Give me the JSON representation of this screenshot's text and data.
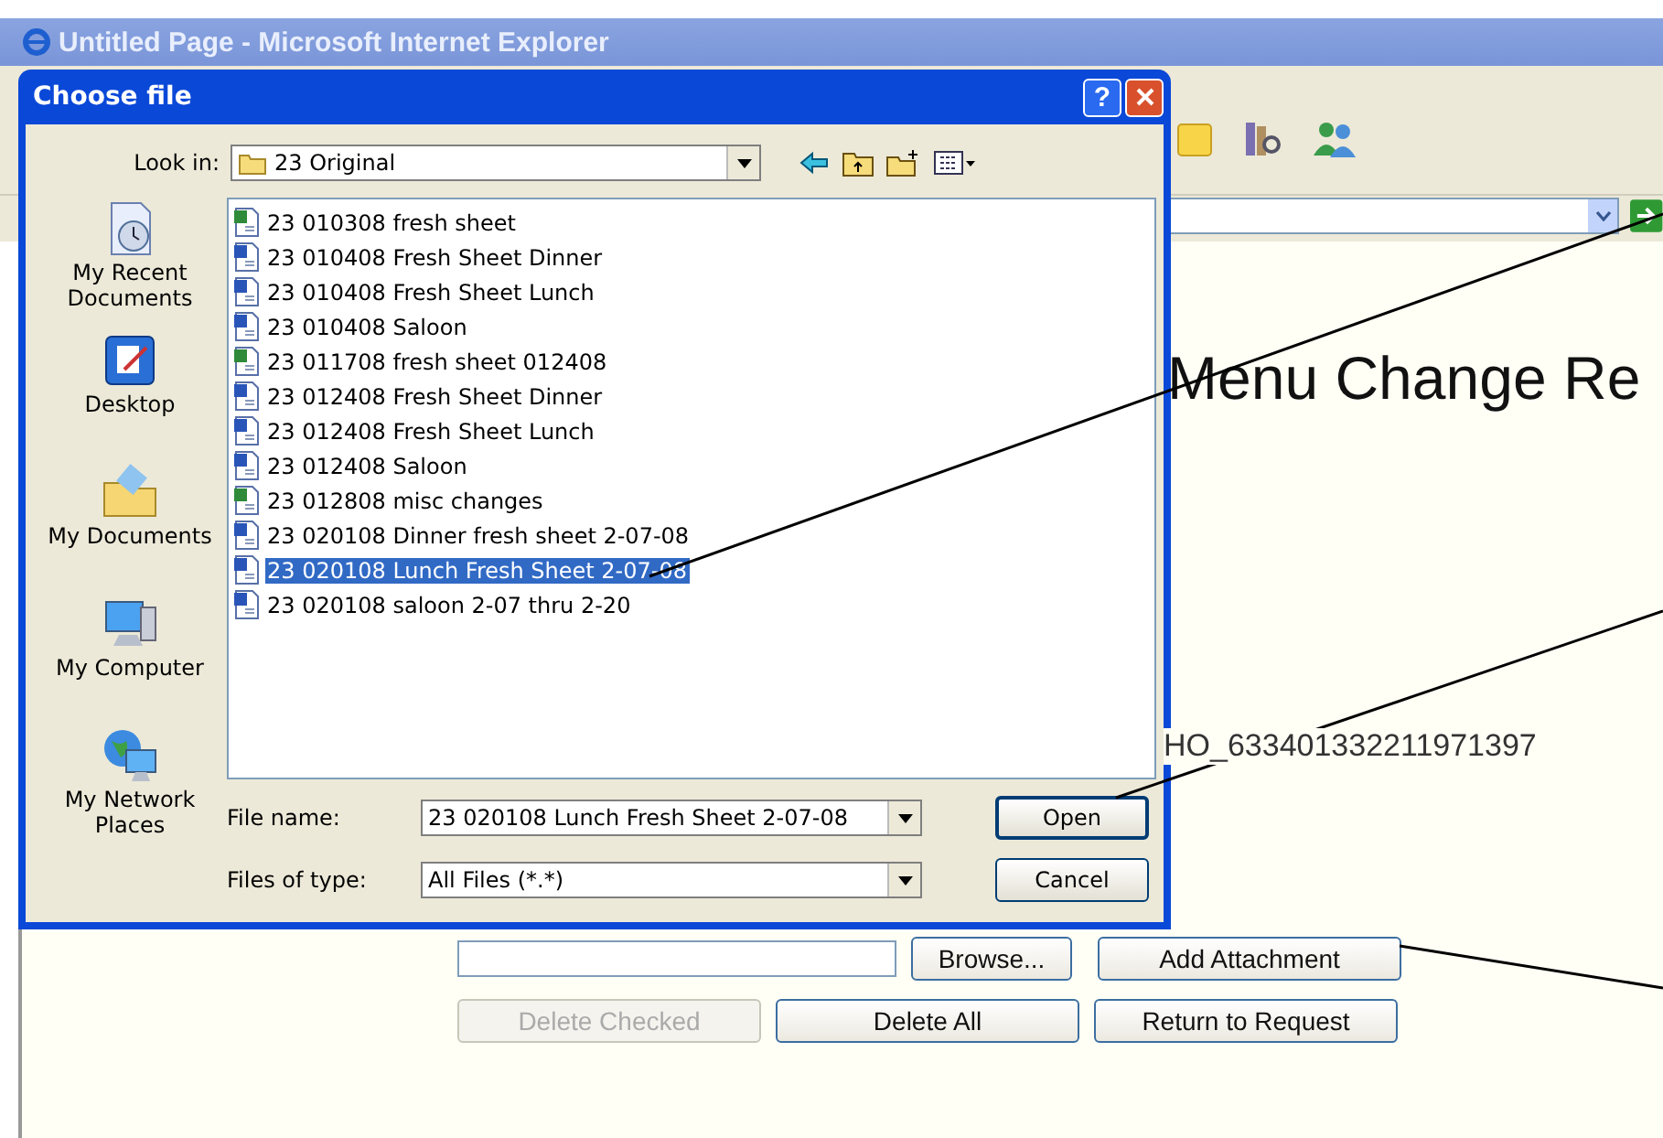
{
  "browser": {
    "title": "Untitled Page - Microsoft Internet Explorer"
  },
  "page": {
    "heading": "Menu Change Re",
    "record_id": "HO_633401332211971397",
    "attachment": {
      "browse": "Browse...",
      "add": "Add Attachment"
    },
    "buttons": [
      {
        "label": "Delete Checked",
        "disabled": true
      },
      {
        "label": "Delete All",
        "disabled": false
      },
      {
        "label": "Return to Request",
        "disabled": false
      }
    ]
  },
  "dialog": {
    "title": "Choose file",
    "help": "?",
    "look_in": {
      "label": "Look in:",
      "value": "23 Original"
    },
    "places": [
      {
        "kind": "recent",
        "label": "My Recent Documents"
      },
      {
        "kind": "desktop",
        "label": "Desktop"
      },
      {
        "kind": "documents",
        "label": "My Documents"
      },
      {
        "kind": "computer",
        "label": "My Computer"
      },
      {
        "kind": "network",
        "label": "My Network Places"
      }
    ],
    "files": [
      {
        "kind": "excel",
        "name": "23 010308 fresh sheet",
        "selected": false
      },
      {
        "kind": "word",
        "name": "23 010408 Fresh Sheet Dinner",
        "selected": false
      },
      {
        "kind": "word",
        "name": "23 010408 Fresh Sheet Lunch",
        "selected": false
      },
      {
        "kind": "word",
        "name": "23 010408 Saloon",
        "selected": false
      },
      {
        "kind": "excel",
        "name": "23 011708 fresh sheet 012408",
        "selected": false
      },
      {
        "kind": "word",
        "name": "23 012408 Fresh Sheet Dinner",
        "selected": false
      },
      {
        "kind": "word",
        "name": "23 012408 Fresh Sheet Lunch",
        "selected": false
      },
      {
        "kind": "word",
        "name": "23 012408 Saloon",
        "selected": false
      },
      {
        "kind": "excel",
        "name": "23 012808 misc changes",
        "selected": false
      },
      {
        "kind": "word",
        "name": "23 020108 Dinner fresh sheet 2-07-08",
        "selected": false
      },
      {
        "kind": "word",
        "name": "23 020108 Lunch Fresh Sheet 2-07-08",
        "selected": true
      },
      {
        "kind": "word",
        "name": "23 020108 saloon 2-07 thru 2-20",
        "selected": false
      }
    ],
    "file_name": {
      "label": "File name:",
      "value": "23 020108 Lunch Fresh Sheet 2-07-08"
    },
    "file_type": {
      "label": "Files of type:",
      "value": "All Files (*.*)"
    },
    "open": "Open",
    "cancel": "Cancel"
  }
}
